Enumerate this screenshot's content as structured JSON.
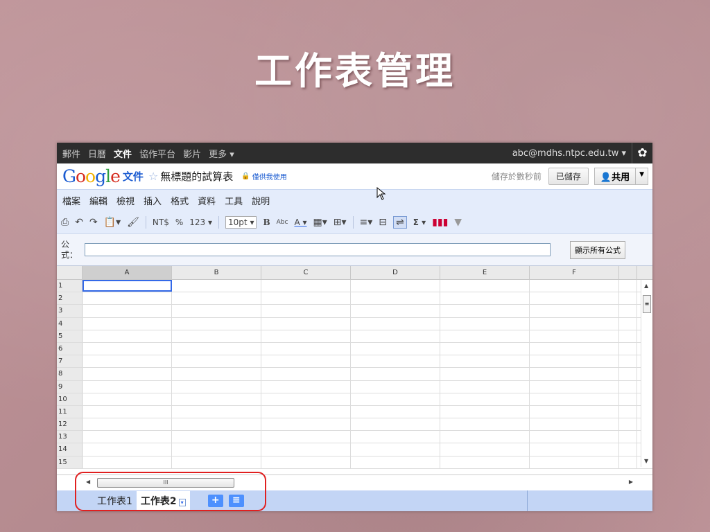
{
  "slide": {
    "title": "工作表管理"
  },
  "topnav": {
    "items": [
      "郵件",
      "日曆",
      "文件",
      "協作平台",
      "影片",
      "更多 ▾"
    ],
    "active_index": 2,
    "account": "abc@mdhs.ntpc.edu.tw ▾"
  },
  "titlebar": {
    "product": "文件",
    "doc_title": "無標題的試算表",
    "private_label": "僅供我使用",
    "saved_status": "儲存於數秒前",
    "saved_button": "已儲存",
    "share_button": "共用"
  },
  "menubar": {
    "items": [
      "檔案",
      "編輯",
      "檢視",
      "插入",
      "格式",
      "資料",
      "工具",
      "說明"
    ]
  },
  "toolbar": {
    "currency": "NT$",
    "percent": "%",
    "number_format": "123 ▾",
    "font_size": "10pt ▾",
    "bold": "B",
    "strike": "Abc",
    "text_color": "A ▾",
    "sum": "Σ ▾"
  },
  "formulabar": {
    "label": "公式：",
    "value": "",
    "show_all_button": "顯示所有公式"
  },
  "grid": {
    "columns": [
      "A",
      "B",
      "C",
      "D",
      "E",
      "F"
    ],
    "rows": [
      "1",
      "2",
      "3",
      "4",
      "5",
      "6",
      "7",
      "8",
      "9",
      "10",
      "11",
      "12",
      "13",
      "14",
      "15"
    ],
    "active_cell": "A1"
  },
  "hscroll": {
    "thumb_grip": "III"
  },
  "sheets": {
    "tabs": [
      "工作表1",
      "工作表2"
    ],
    "current_index": 1,
    "add_button": "+",
    "list_button": "≡"
  },
  "colors": {
    "accent_blue": "#4d90fe",
    "highlight_red": "#e02020",
    "nav_bg": "#2d2d2d"
  }
}
